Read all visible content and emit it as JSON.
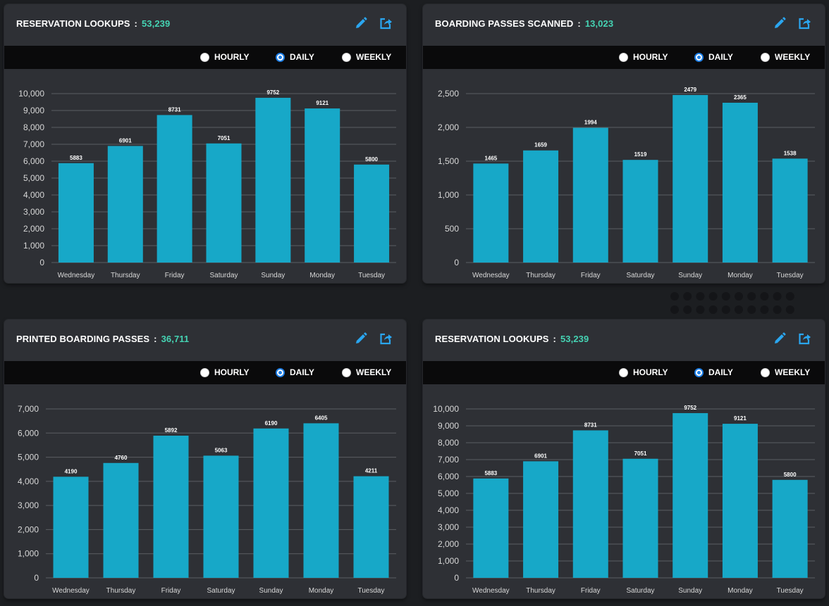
{
  "colors": {
    "bar": "#17a8c8",
    "count": "#45d3b3",
    "panel": "#2e3035",
    "toolbar": "#0a0a0b",
    "radio_accent": "#1e7fe6"
  },
  "panels": [
    {
      "title": "RESERVATION LOOKUPS",
      "separator": ":",
      "count": "53,239",
      "edit_icon": "pencil-icon",
      "export_icon": "share-export-icon",
      "options": [
        "HOURLY",
        "DAILY",
        "WEEKLY"
      ],
      "selected": "DAILY"
    },
    {
      "title": "BOARDING PASSES SCANNED",
      "separator": ":",
      "count": "13,023",
      "edit_icon": "pencil-icon",
      "export_icon": "share-export-icon",
      "options": [
        "HOURLY",
        "DAILY",
        "WEEKLY"
      ],
      "selected": "DAILY"
    },
    {
      "title": "PRINTED BOARDING PASSES",
      "separator": ":",
      "count": "36,711",
      "edit_icon": "pencil-icon",
      "export_icon": "share-export-icon",
      "options": [
        "HOURLY",
        "DAILY",
        "WEEKLY"
      ],
      "selected": "DAILY"
    },
    {
      "title": "RESERVATION LOOKUPS",
      "separator": ":",
      "count": "53,239",
      "edit_icon": "pencil-icon",
      "export_icon": "share-export-icon",
      "options": [
        "HOURLY",
        "DAILY",
        "WEEKLY"
      ],
      "selected": "DAILY"
    }
  ],
  "chart_data": [
    {
      "type": "bar",
      "title": "RESERVATION LOOKUPS",
      "categories": [
        "Wednesday",
        "Thursday",
        "Friday",
        "Saturday",
        "Sunday",
        "Monday",
        "Tuesday"
      ],
      "values": [
        5883,
        6901,
        8731,
        7051,
        9752,
        9121,
        5800
      ],
      "ylim": [
        0,
        10000
      ],
      "yticks": [
        0,
        1000,
        2000,
        3000,
        4000,
        5000,
        6000,
        7000,
        8000,
        9000,
        10000
      ],
      "ytick_labels": [
        "0",
        "1,000",
        "2,000",
        "3,000",
        "4,000",
        "5,000",
        "6,000",
        "7,000",
        "8,000",
        "9,000",
        "10,000"
      ],
      "grid": true,
      "data_labels": true
    },
    {
      "type": "bar",
      "title": "BOARDING PASSES SCANNED",
      "categories": [
        "Wednesday",
        "Thursday",
        "Friday",
        "Saturday",
        "Sunday",
        "Monday",
        "Tuesday"
      ],
      "values": [
        1465,
        1659,
        1994,
        1519,
        2479,
        2365,
        1538
      ],
      "ylim": [
        0,
        2500
      ],
      "yticks": [
        0,
        500,
        1000,
        1500,
        2000,
        2500
      ],
      "ytick_labels": [
        "0",
        "500",
        "1,000",
        "1,500",
        "2,000",
        "2,500"
      ],
      "grid": true,
      "data_labels": true
    },
    {
      "type": "bar",
      "title": "PRINTED BOARDING PASSES",
      "categories": [
        "Wednesday",
        "Thursday",
        "Friday",
        "Saturday",
        "Sunday",
        "Monday",
        "Tuesday"
      ],
      "values": [
        4190,
        4760,
        5892,
        5063,
        6190,
        6405,
        4211
      ],
      "ylim": [
        0,
        7000
      ],
      "yticks": [
        0,
        1000,
        2000,
        3000,
        4000,
        5000,
        6000,
        7000
      ],
      "ytick_labels": [
        "0",
        "1,000",
        "2,000",
        "3,000",
        "4,000",
        "5,000",
        "6,000",
        "7,000"
      ],
      "grid": true,
      "data_labels": true
    },
    {
      "type": "bar",
      "title": "RESERVATION LOOKUPS",
      "categories": [
        "Wednesday",
        "Thursday",
        "Friday",
        "Saturday",
        "Sunday",
        "Monday",
        "Tuesday"
      ],
      "values": [
        5883,
        6901,
        8731,
        7051,
        9752,
        9121,
        5800
      ],
      "ylim": [
        0,
        10000
      ],
      "yticks": [
        0,
        1000,
        2000,
        3000,
        4000,
        5000,
        6000,
        7000,
        8000,
        9000,
        10000
      ],
      "ytick_labels": [
        "0",
        "1,000",
        "2,000",
        "3,000",
        "4,000",
        "5,000",
        "6,000",
        "7,000",
        "8,000",
        "9,000",
        "10,000"
      ],
      "grid": true,
      "data_labels": true
    }
  ]
}
